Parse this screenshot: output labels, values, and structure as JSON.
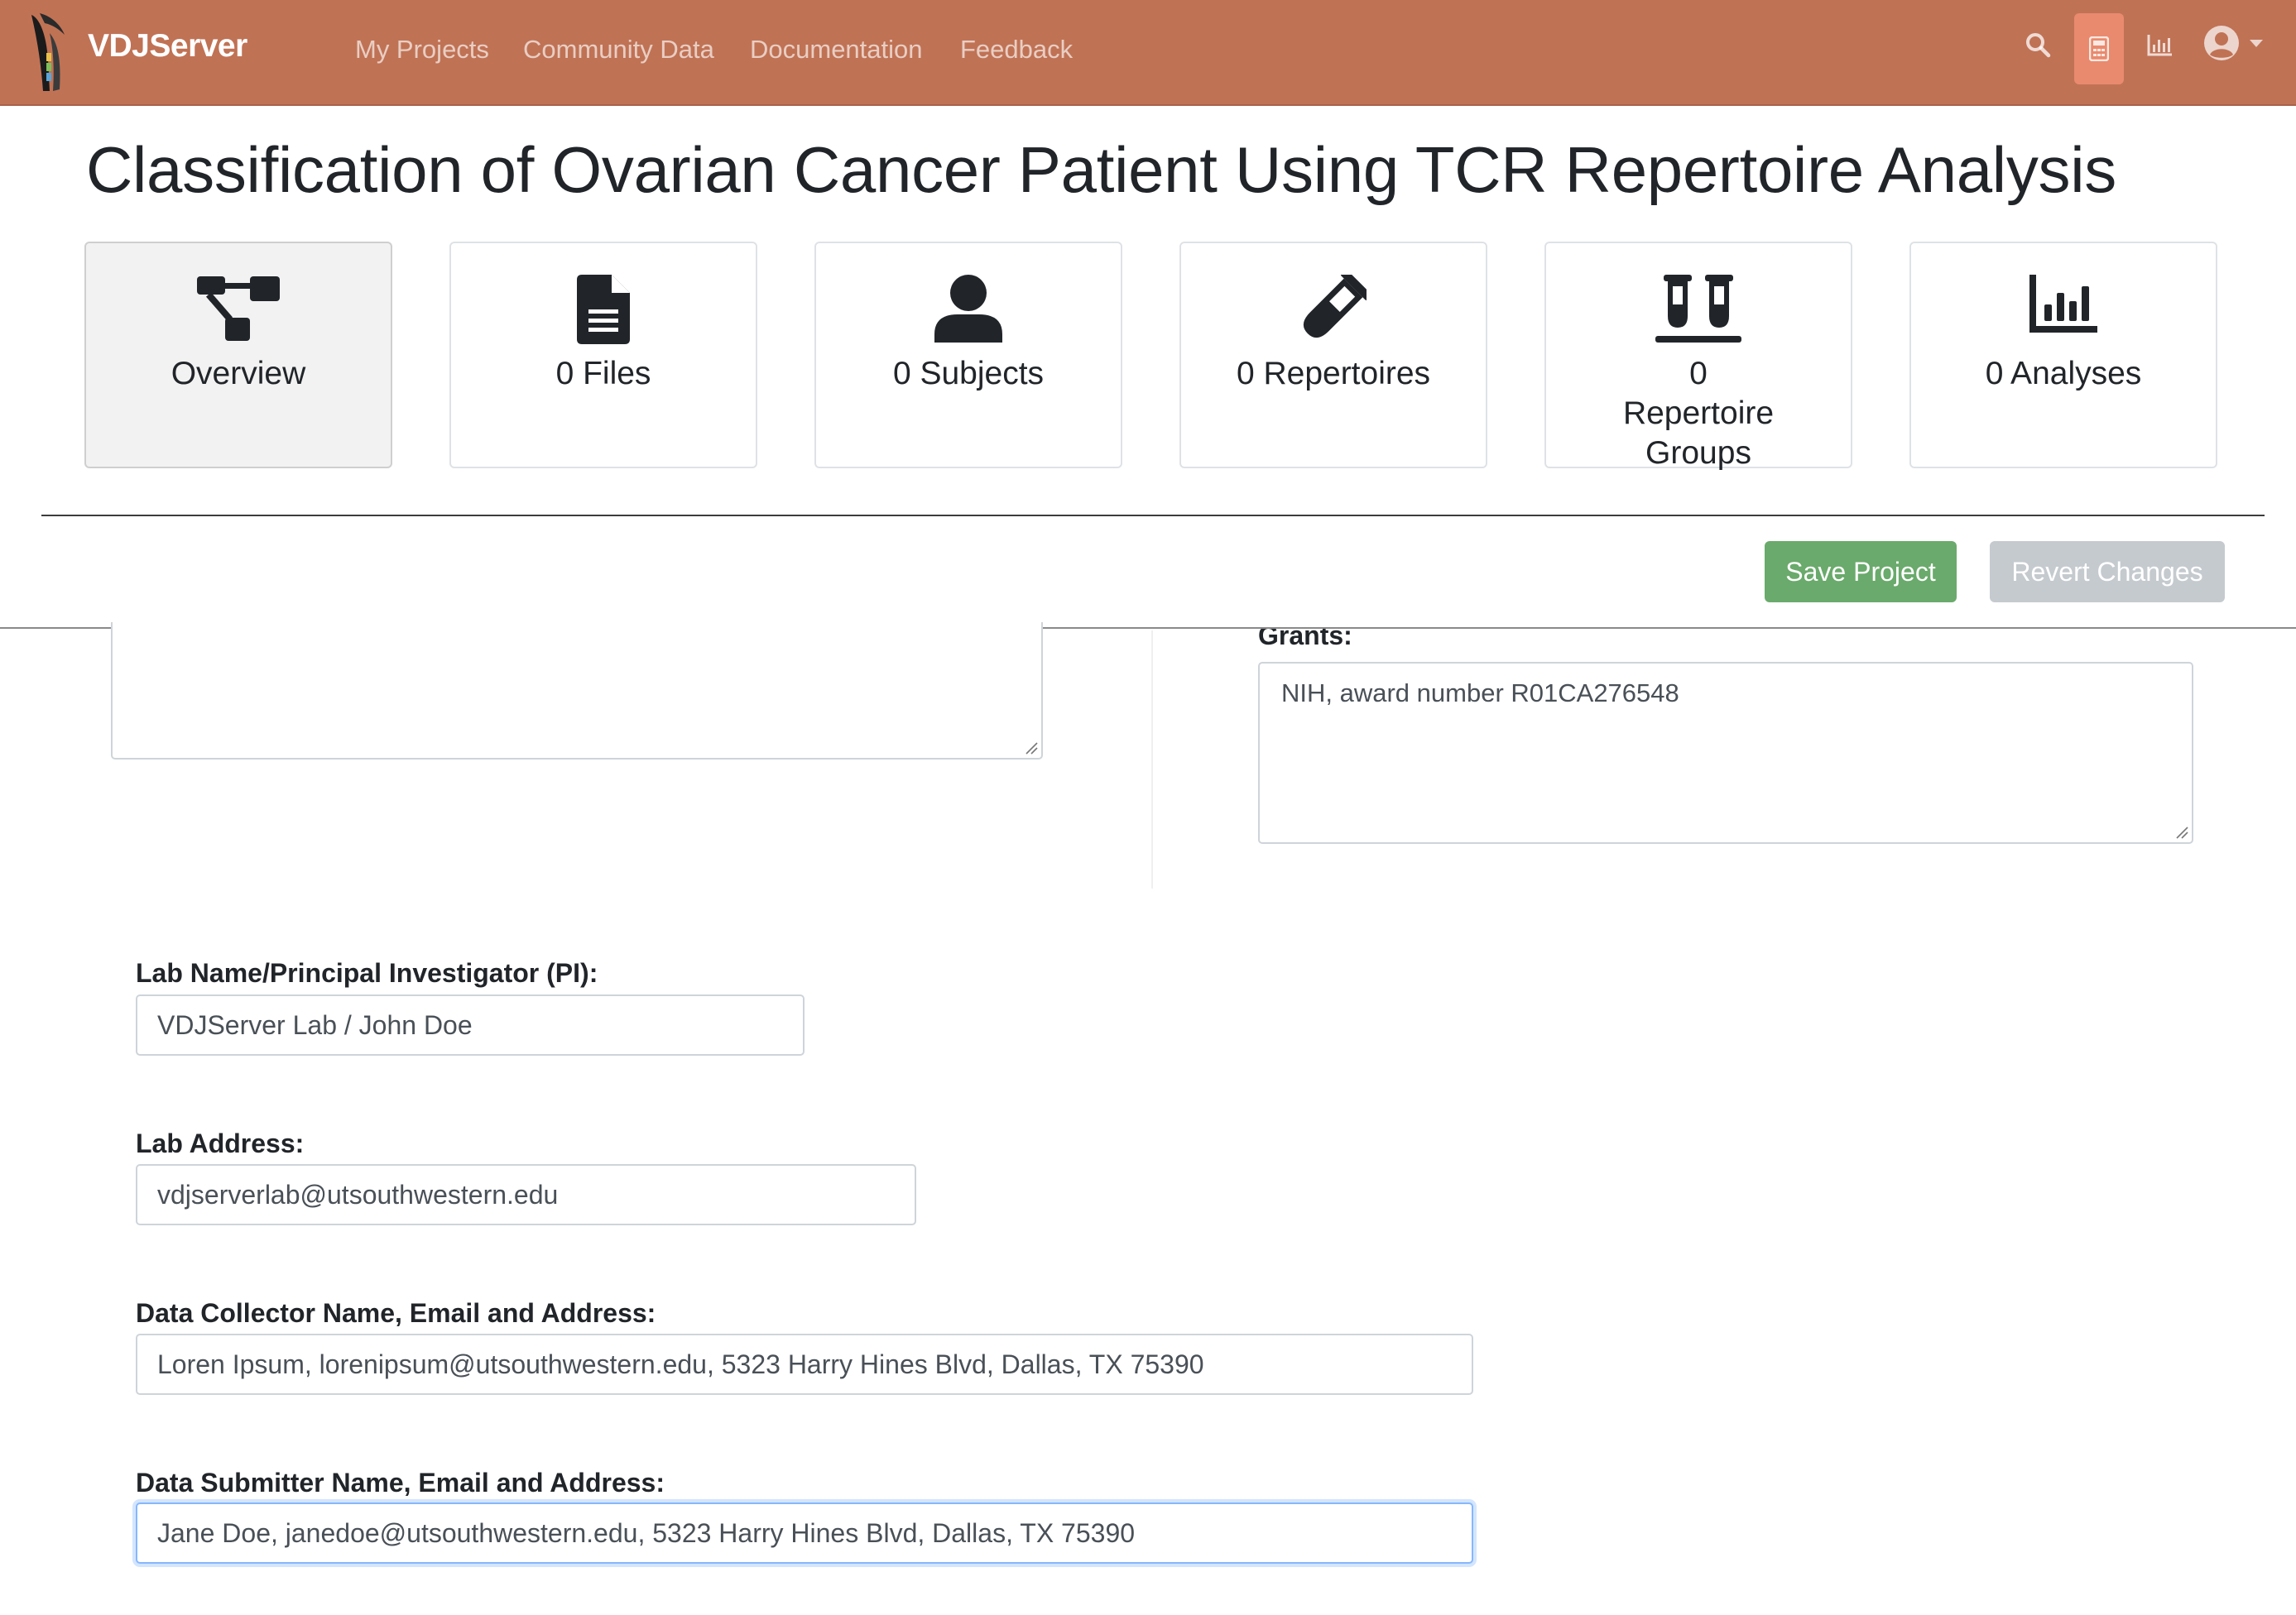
{
  "navbar": {
    "brand": "VDJServer",
    "links": [
      "My Projects",
      "Community Data",
      "Documentation",
      "Feedback"
    ],
    "icons": [
      "search-icon",
      "calculator-icon",
      "bar-chart-icon",
      "user-circle-icon"
    ],
    "colors": {
      "background": "#c07255",
      "active_icon_bg": "#e98a6e"
    }
  },
  "project": {
    "title": "Classification of Ovarian Cancer Patient Using TCR Repertoire Analysis"
  },
  "tiles": [
    {
      "label": "Overview",
      "icon": "sitemap-icon"
    },
    {
      "label": "0 Files",
      "icon": "file-icon"
    },
    {
      "label": "0 Subjects",
      "icon": "user-icon"
    },
    {
      "label": "0 Repertoires",
      "icon": "vial-icon"
    },
    {
      "label": "0 Repertoire Groups",
      "icon": "vials-icon"
    },
    {
      "label": "0 Analyses",
      "icon": "chart-icon"
    }
  ],
  "actions": {
    "save": "Save Project",
    "revert": "Revert Changes"
  },
  "form": {
    "grants_label": "Grants:",
    "grants_value": "NIH, award number R01CA276548",
    "lab_name_label": "Lab Name/Principal Investigator (PI):",
    "lab_name_value": "VDJServer Lab / John Doe",
    "lab_address_label": "Lab Address:",
    "lab_address_value": "vdjserverlab@utsouthwestern.edu",
    "collector_label": "Data Collector Name, Email and Address:",
    "collector_value": "Loren Ipsum, lorenipsum@utsouthwestern.edu, 5323 Harry Hines Blvd, Dallas, TX 75390",
    "submitter_label": "Data Submitter Name, Email and Address:",
    "submitter_value": "Jane Doe, janedoe@utsouthwestern.edu, 5323 Harry Hines Blvd, Dallas, TX 75390"
  }
}
